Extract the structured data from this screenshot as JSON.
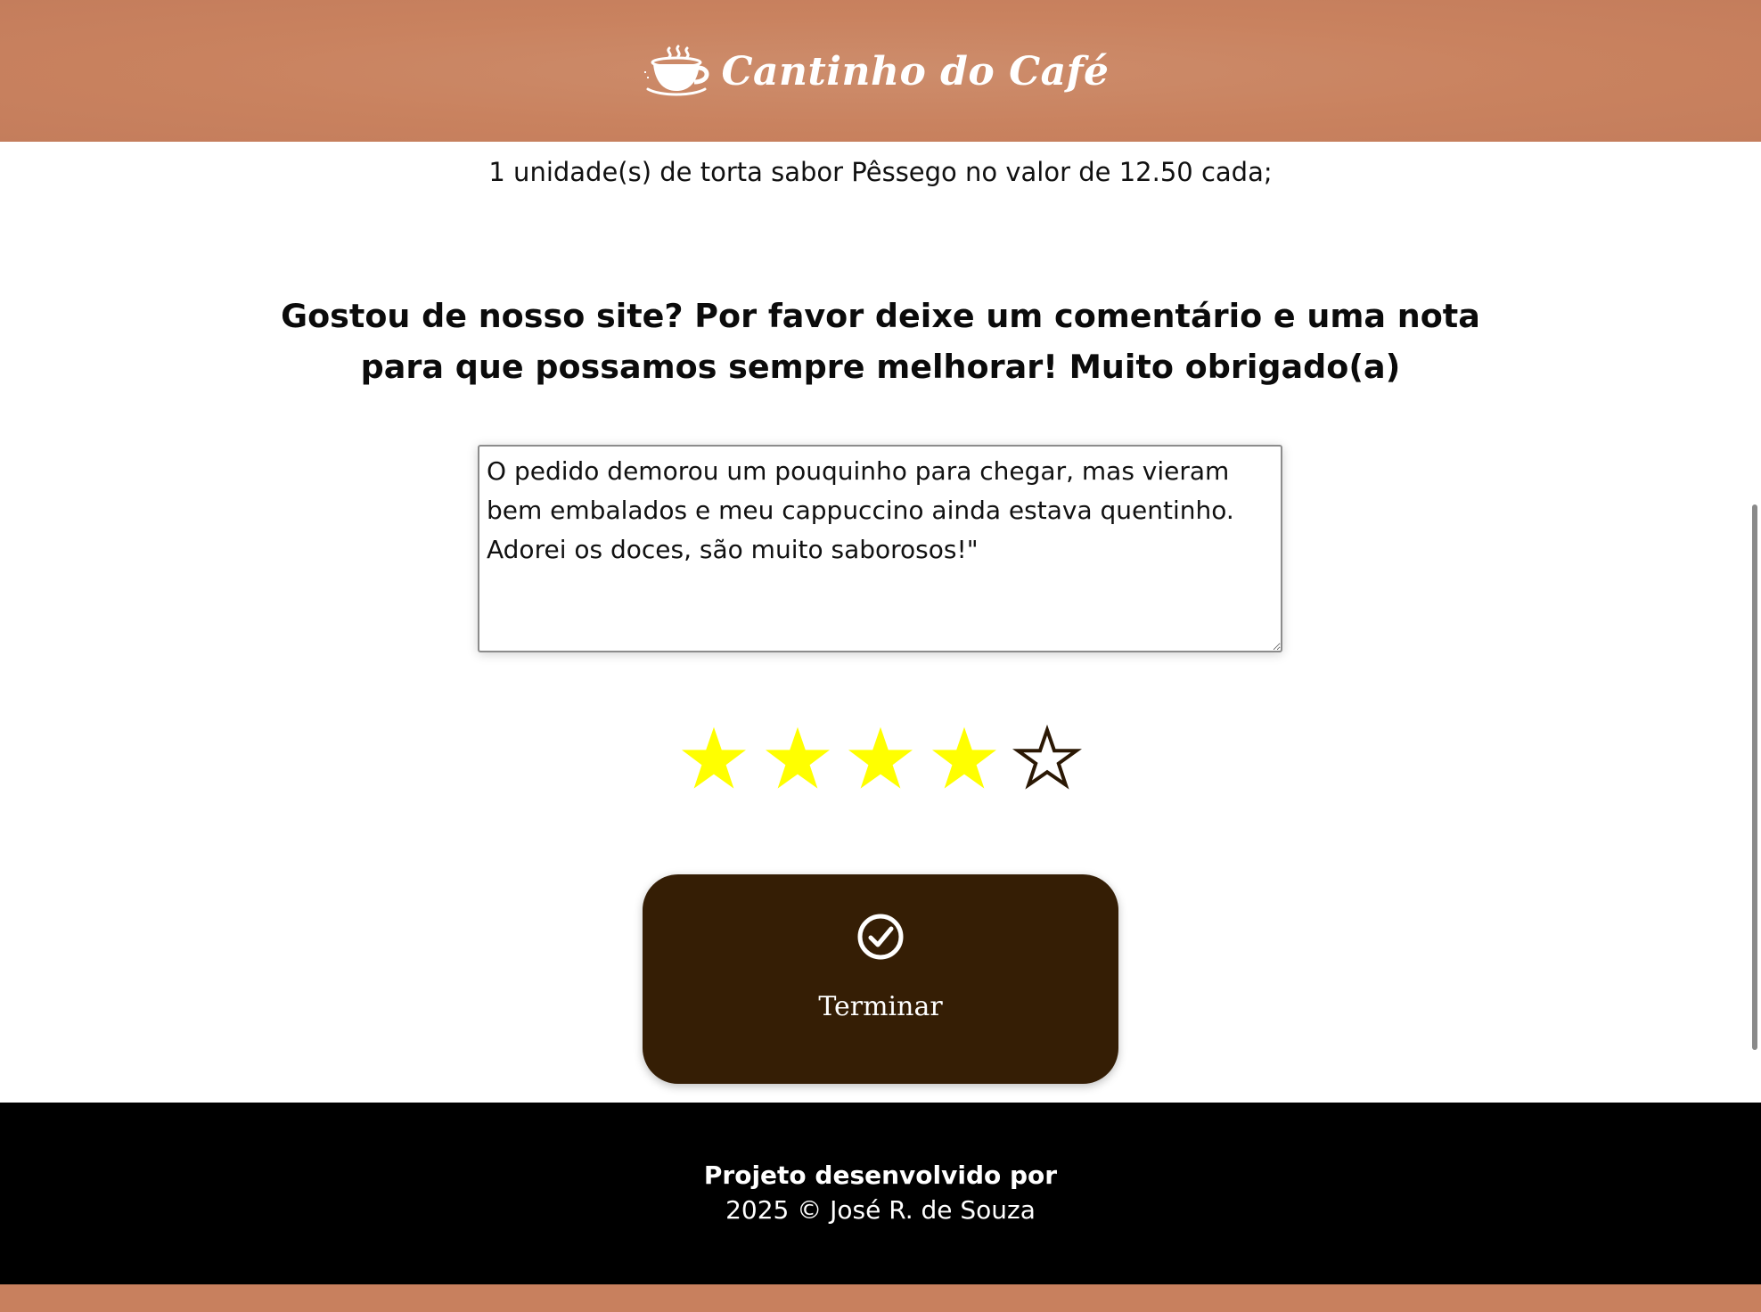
{
  "header": {
    "brand_title": "Cantinho do Café",
    "logo_icon": "coffee-cup-icon",
    "background_color": "#c9825f"
  },
  "order": {
    "summary_line": "1 unidade(s) de torta sabor Pêssego no valor de 12.50 cada;"
  },
  "feedback": {
    "prompt": "Gostou de nosso site? Por favor deixe um comentário e uma nota para que possamos sempre melhorar! Muito obrigado(a)",
    "comment_value": "O pedido demorou um pouquinho para chegar, mas vieram bem embalados e meu cappuccino ainda estava quentinho. Adorei os doces, são muito saborosos!\"",
    "rating": {
      "value": 4,
      "max": 5,
      "filled_color": "#ffff00",
      "empty_outline_color": "#2b1804"
    }
  },
  "finish_button": {
    "icon": "check-circle-icon",
    "label": "Terminar",
    "background_color": "#351e05"
  },
  "footer": {
    "line1": "Projeto desenvolvido por",
    "line2": "2025 © José R. de Souza",
    "background_color": "#000000"
  }
}
